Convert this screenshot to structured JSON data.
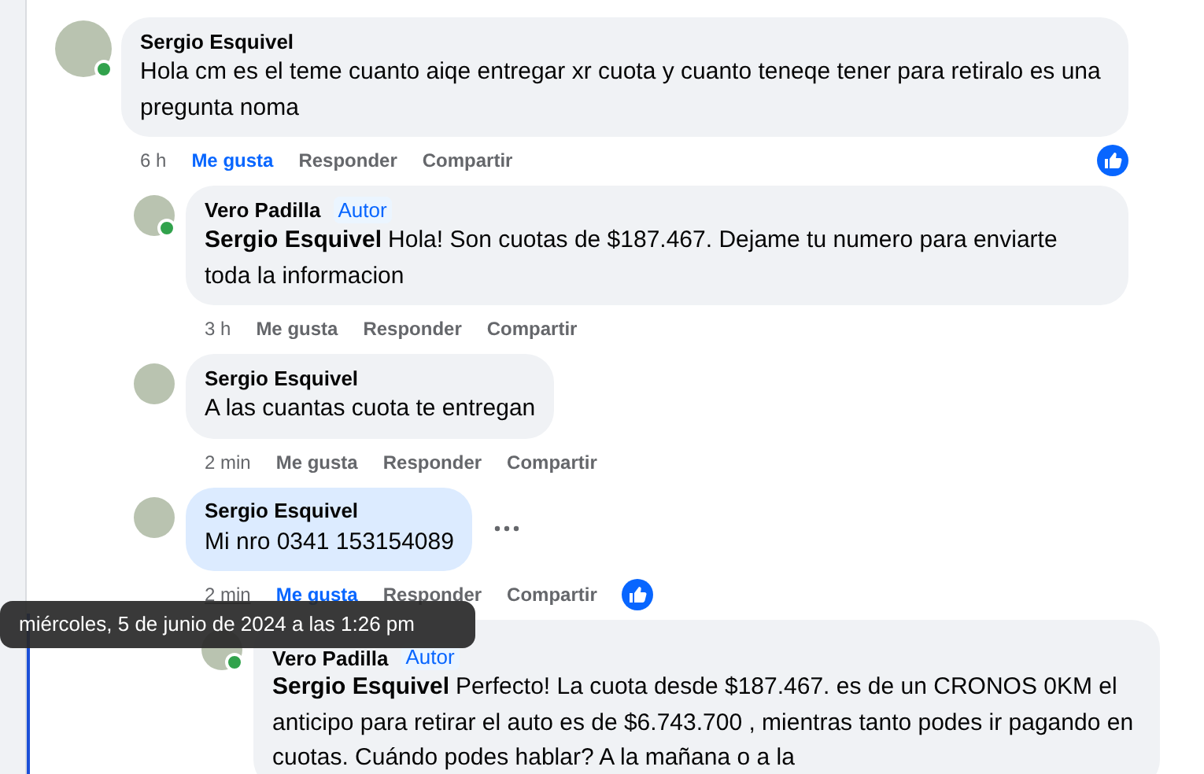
{
  "comments": [
    {
      "author": "Sergio Esquivel",
      "online": true,
      "text": "Hola cm es el teme cuanto aiqe entregar xr cuota y cuanto teneqe tener para retiralo es una pregunta noma",
      "time": "6 h",
      "time_hovered": false,
      "liked": true,
      "reaction": true,
      "actions": [
        "Me gusta",
        "Responder",
        "Compartir"
      ],
      "children": [
        {
          "author": "Vero Padilla",
          "badge": "Autor",
          "online": true,
          "mention": "Sergio Esquivel",
          "text": "Hola! Son cuotas de $187.467. Dejame tu numero para enviarte toda la informacion",
          "time": "3 h",
          "time_hovered": false,
          "liked": false,
          "actions": [
            "Me gusta",
            "Responder",
            "Compartir"
          ]
        },
        {
          "author": "Sergio Esquivel",
          "online": false,
          "text": "A las cuantas cuota te entregan",
          "time": "2 min",
          "time_hovered": false,
          "liked": false,
          "actions": [
            "Me gusta",
            "Responder",
            "Compartir"
          ]
        },
        {
          "author": "Sergio Esquivel",
          "online": false,
          "text": "Mi nro 0341 153154089",
          "time": "2 min",
          "time_hovered": true,
          "liked": true,
          "reaction": true,
          "more_button": true,
          "highlighted": true,
          "actions": [
            "Me gusta",
            "Responder",
            "Compartir"
          ],
          "children": [
            {
              "author": "Vero Padilla",
              "badge": "Autor",
              "online": true,
              "mention": "Sergio Esquivel",
              "text": "Perfecto! La cuota desde $187.467. es de un CRONOS 0KM el anticipo para retirar el auto es de $6.743.700 , mientras tanto podes ir pagando en cuotas. Cuándo podes hablar? A la mañana o a la"
            }
          ]
        }
      ]
    }
  ],
  "tooltip": "miércoles, 5 de junio de 2024 a las 1:26 pm"
}
